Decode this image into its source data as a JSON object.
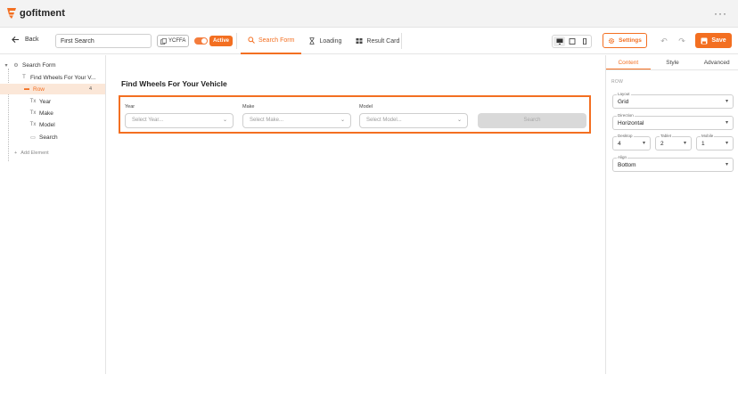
{
  "app": {
    "name": "gofitment",
    "more_icon": "more-horizontal-icon"
  },
  "toolbar": {
    "back_label": "Back",
    "form_name": "First Search",
    "code": "YCFFA",
    "active_label": "Active",
    "tabs": [
      {
        "label": "Search Form",
        "icon": "search-icon",
        "active": true
      },
      {
        "label": "Loading",
        "icon": "hourglass-icon",
        "active": false
      },
      {
        "label": "Result Card",
        "icon": "grid-icon",
        "active": false
      }
    ],
    "settings_label": "Settings",
    "save_label": "Save",
    "accent": "#f36f21"
  },
  "tree": {
    "root": "Search Form",
    "title_item": "Find Wheels For Your V...",
    "row_item": "Row",
    "row_count": "4",
    "children": [
      "Year",
      "Make",
      "Model",
      "Search"
    ],
    "add_element": "Add Element"
  },
  "canvas": {
    "title": "Find Wheels For Your Vehicle",
    "fields": [
      {
        "label": "Year",
        "placeholder": "Select Year..."
      },
      {
        "label": "Make",
        "placeholder": "Select Make..."
      },
      {
        "label": "Model",
        "placeholder": "Select Model..."
      }
    ],
    "search_label": "Search"
  },
  "props": {
    "tabs": [
      "Content",
      "Style",
      "Advanced"
    ],
    "section": "ROW",
    "layout": {
      "label": "Layout",
      "value": "Grid"
    },
    "direction": {
      "label": "Direction",
      "value": "Horizontal"
    },
    "desktop": {
      "label": "Desktop",
      "value": "4"
    },
    "tablet": {
      "label": "Tablet",
      "value": "2"
    },
    "mobile": {
      "label": "Mobile",
      "value": "1"
    },
    "align": {
      "label": "Align",
      "value": "Bottom"
    }
  }
}
